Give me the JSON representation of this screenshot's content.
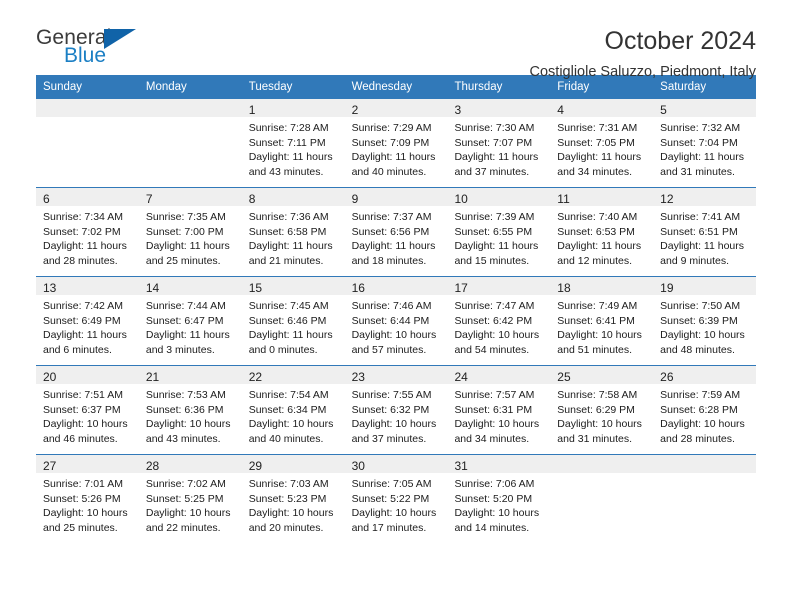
{
  "brand": {
    "name_top": "General",
    "name_bottom": "Blue"
  },
  "header": {
    "title": "October 2024",
    "subtitle": "Costigliole Saluzzo, Piedmont, Italy"
  },
  "calendar": {
    "weekday_headers": [
      "Sunday",
      "Monday",
      "Tuesday",
      "Wednesday",
      "Thursday",
      "Friday",
      "Saturday"
    ],
    "accent_color": "#3179b9",
    "datebar_color": "#efefef",
    "labels": {
      "sunrise": "Sunrise:",
      "sunset": "Sunset:",
      "daylight": "Daylight:"
    },
    "weeks": [
      [
        {
          "day": ""
        },
        {
          "day": ""
        },
        {
          "day": "1",
          "sunrise": "Sunrise: 7:28 AM",
          "sunset": "Sunset: 7:11 PM",
          "daylight": "Daylight: 11 hours and 43 minutes."
        },
        {
          "day": "2",
          "sunrise": "Sunrise: 7:29 AM",
          "sunset": "Sunset: 7:09 PM",
          "daylight": "Daylight: 11 hours and 40 minutes."
        },
        {
          "day": "3",
          "sunrise": "Sunrise: 7:30 AM",
          "sunset": "Sunset: 7:07 PM",
          "daylight": "Daylight: 11 hours and 37 minutes."
        },
        {
          "day": "4",
          "sunrise": "Sunrise: 7:31 AM",
          "sunset": "Sunset: 7:05 PM",
          "daylight": "Daylight: 11 hours and 34 minutes."
        },
        {
          "day": "5",
          "sunrise": "Sunrise: 7:32 AM",
          "sunset": "Sunset: 7:04 PM",
          "daylight": "Daylight: 11 hours and 31 minutes."
        }
      ],
      [
        {
          "day": "6",
          "sunrise": "Sunrise: 7:34 AM",
          "sunset": "Sunset: 7:02 PM",
          "daylight": "Daylight: 11 hours and 28 minutes."
        },
        {
          "day": "7",
          "sunrise": "Sunrise: 7:35 AM",
          "sunset": "Sunset: 7:00 PM",
          "daylight": "Daylight: 11 hours and 25 minutes."
        },
        {
          "day": "8",
          "sunrise": "Sunrise: 7:36 AM",
          "sunset": "Sunset: 6:58 PM",
          "daylight": "Daylight: 11 hours and 21 minutes."
        },
        {
          "day": "9",
          "sunrise": "Sunrise: 7:37 AM",
          "sunset": "Sunset: 6:56 PM",
          "daylight": "Daylight: 11 hours and 18 minutes."
        },
        {
          "day": "10",
          "sunrise": "Sunrise: 7:39 AM",
          "sunset": "Sunset: 6:55 PM",
          "daylight": "Daylight: 11 hours and 15 minutes."
        },
        {
          "day": "11",
          "sunrise": "Sunrise: 7:40 AM",
          "sunset": "Sunset: 6:53 PM",
          "daylight": "Daylight: 11 hours and 12 minutes."
        },
        {
          "day": "12",
          "sunrise": "Sunrise: 7:41 AM",
          "sunset": "Sunset: 6:51 PM",
          "daylight": "Daylight: 11 hours and 9 minutes."
        }
      ],
      [
        {
          "day": "13",
          "sunrise": "Sunrise: 7:42 AM",
          "sunset": "Sunset: 6:49 PM",
          "daylight": "Daylight: 11 hours and 6 minutes."
        },
        {
          "day": "14",
          "sunrise": "Sunrise: 7:44 AM",
          "sunset": "Sunset: 6:47 PM",
          "daylight": "Daylight: 11 hours and 3 minutes."
        },
        {
          "day": "15",
          "sunrise": "Sunrise: 7:45 AM",
          "sunset": "Sunset: 6:46 PM",
          "daylight": "Daylight: 11 hours and 0 minutes."
        },
        {
          "day": "16",
          "sunrise": "Sunrise: 7:46 AM",
          "sunset": "Sunset: 6:44 PM",
          "daylight": "Daylight: 10 hours and 57 minutes."
        },
        {
          "day": "17",
          "sunrise": "Sunrise: 7:47 AM",
          "sunset": "Sunset: 6:42 PM",
          "daylight": "Daylight: 10 hours and 54 minutes."
        },
        {
          "day": "18",
          "sunrise": "Sunrise: 7:49 AM",
          "sunset": "Sunset: 6:41 PM",
          "daylight": "Daylight: 10 hours and 51 minutes."
        },
        {
          "day": "19",
          "sunrise": "Sunrise: 7:50 AM",
          "sunset": "Sunset: 6:39 PM",
          "daylight": "Daylight: 10 hours and 48 minutes."
        }
      ],
      [
        {
          "day": "20",
          "sunrise": "Sunrise: 7:51 AM",
          "sunset": "Sunset: 6:37 PM",
          "daylight": "Daylight: 10 hours and 46 minutes."
        },
        {
          "day": "21",
          "sunrise": "Sunrise: 7:53 AM",
          "sunset": "Sunset: 6:36 PM",
          "daylight": "Daylight: 10 hours and 43 minutes."
        },
        {
          "day": "22",
          "sunrise": "Sunrise: 7:54 AM",
          "sunset": "Sunset: 6:34 PM",
          "daylight": "Daylight: 10 hours and 40 minutes."
        },
        {
          "day": "23",
          "sunrise": "Sunrise: 7:55 AM",
          "sunset": "Sunset: 6:32 PM",
          "daylight": "Daylight: 10 hours and 37 minutes."
        },
        {
          "day": "24",
          "sunrise": "Sunrise: 7:57 AM",
          "sunset": "Sunset: 6:31 PM",
          "daylight": "Daylight: 10 hours and 34 minutes."
        },
        {
          "day": "25",
          "sunrise": "Sunrise: 7:58 AM",
          "sunset": "Sunset: 6:29 PM",
          "daylight": "Daylight: 10 hours and 31 minutes."
        },
        {
          "day": "26",
          "sunrise": "Sunrise: 7:59 AM",
          "sunset": "Sunset: 6:28 PM",
          "daylight": "Daylight: 10 hours and 28 minutes."
        }
      ],
      [
        {
          "day": "27",
          "sunrise": "Sunrise: 7:01 AM",
          "sunset": "Sunset: 5:26 PM",
          "daylight": "Daylight: 10 hours and 25 minutes."
        },
        {
          "day": "28",
          "sunrise": "Sunrise: 7:02 AM",
          "sunset": "Sunset: 5:25 PM",
          "daylight": "Daylight: 10 hours and 22 minutes."
        },
        {
          "day": "29",
          "sunrise": "Sunrise: 7:03 AM",
          "sunset": "Sunset: 5:23 PM",
          "daylight": "Daylight: 10 hours and 20 minutes."
        },
        {
          "day": "30",
          "sunrise": "Sunrise: 7:05 AM",
          "sunset": "Sunset: 5:22 PM",
          "daylight": "Daylight: 10 hours and 17 minutes."
        },
        {
          "day": "31",
          "sunrise": "Sunrise: 7:06 AM",
          "sunset": "Sunset: 5:20 PM",
          "daylight": "Daylight: 10 hours and 14 minutes."
        },
        {
          "day": ""
        },
        {
          "day": ""
        }
      ]
    ]
  }
}
